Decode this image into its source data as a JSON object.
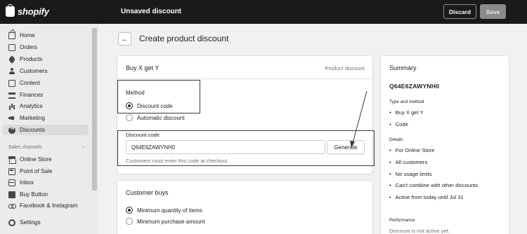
{
  "topbar": {
    "brand": "shopify",
    "title": "Unsaved discount",
    "discard_label": "Discard",
    "save_label": "Save"
  },
  "sidebar": {
    "items": [
      {
        "label": "Home",
        "icon": "home-icon"
      },
      {
        "label": "Orders",
        "icon": "orders-icon"
      },
      {
        "label": "Products",
        "icon": "tag-icon"
      },
      {
        "label": "Customers",
        "icon": "person-icon"
      },
      {
        "label": "Content",
        "icon": "document-icon"
      },
      {
        "label": "Finances",
        "icon": "bank-icon"
      },
      {
        "label": "Analytics",
        "icon": "chart-icon"
      },
      {
        "label": "Marketing",
        "icon": "megaphone-icon"
      },
      {
        "label": "Discounts",
        "icon": "discount-icon",
        "active": true
      }
    ],
    "sales_channels_heading": "Sales channels",
    "channels": [
      {
        "label": "Online Store",
        "icon": "store-icon"
      },
      {
        "label": "Point of Sale",
        "icon": "pos-icon"
      },
      {
        "label": "Inbox",
        "icon": "inbox-icon"
      },
      {
        "label": "Buy Button",
        "icon": "buy-button-icon"
      },
      {
        "label": "Facebook & Instagram",
        "icon": "facebook-instagram-icon"
      }
    ],
    "settings_label": "Settings"
  },
  "page": {
    "title": "Create product discount"
  },
  "discount_card": {
    "title": "Buy X get Y",
    "meta": "Product discount",
    "method_label": "Method",
    "method_options": [
      "Discount code",
      "Automatic discount"
    ],
    "method_selected": "Discount code",
    "code_label": "Discount code",
    "code_value": "Q64E6ZAWYNH0",
    "generate_label": "Generate",
    "help_text": "Customers must enter this code at checkout."
  },
  "buys_card": {
    "title": "Customer buys",
    "options": [
      "Minimum quantity of items",
      "Minimum purchase amount"
    ],
    "selected": "Minimum quantity of items"
  },
  "summary": {
    "title": "Summary",
    "code": "Q64E6ZAWYNH0",
    "type_heading": "Type and method",
    "type_items": [
      "Buy X get Y",
      "Code"
    ],
    "details_heading": "Details",
    "details_items": [
      "For Online Store",
      "All customers",
      "No usage limits",
      "Can't combine with other discounts",
      "Active from today until Jul 31"
    ],
    "performance_heading": "Performance",
    "performance_text": "Discount is not active yet."
  },
  "colors": {
    "topbar_bg": "#1a1a1a",
    "page_bg": "#f1f1f1",
    "annotation": "#3a3a3a"
  }
}
